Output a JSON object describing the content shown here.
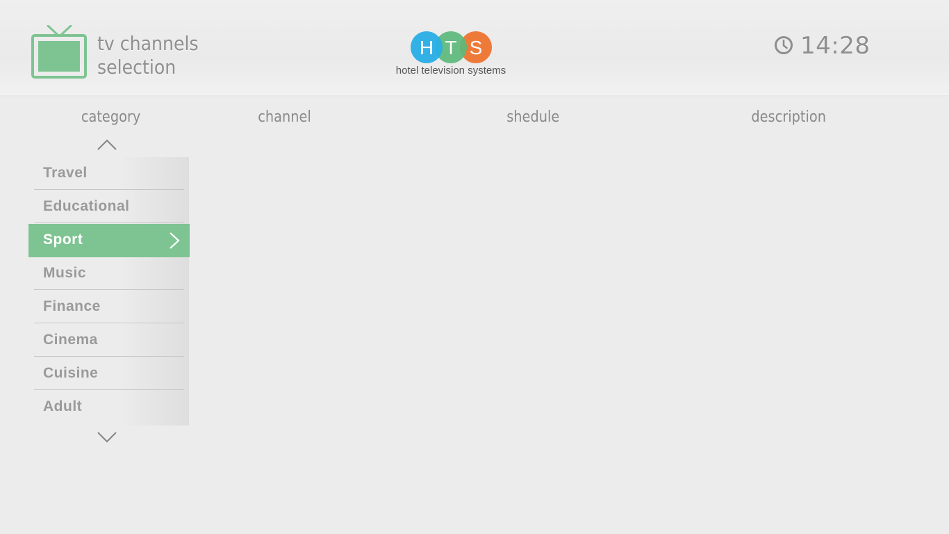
{
  "header": {
    "title_line1": "tv channels",
    "title_line2": "selection",
    "logo_letters": [
      "H",
      "T",
      "S"
    ],
    "logo_tagline": "hotel television systems",
    "time": "14:28"
  },
  "columns": {
    "category": "category",
    "channel": "channel",
    "schedule": "shedule",
    "description": "description"
  },
  "categories": [
    "Travel",
    "Educational",
    "Sport",
    "Music",
    "Finance",
    "Cinema",
    "Cuisine",
    "Adult"
  ],
  "selected_category": "Sport",
  "icons": {
    "tv": "tv-icon",
    "clock": "clock-icon",
    "scroll_up": "chevron-up-icon",
    "scroll_down": "chevron-down-icon",
    "selected_indicator": "chevron-right-icon"
  },
  "colors": {
    "accent_green": "#7ec492",
    "logo_blue": "#29aee6",
    "logo_green": "#5bb97a",
    "logo_orange": "#ee7a3a",
    "background": "#ececec",
    "muted_text": "#9a9a9a"
  }
}
